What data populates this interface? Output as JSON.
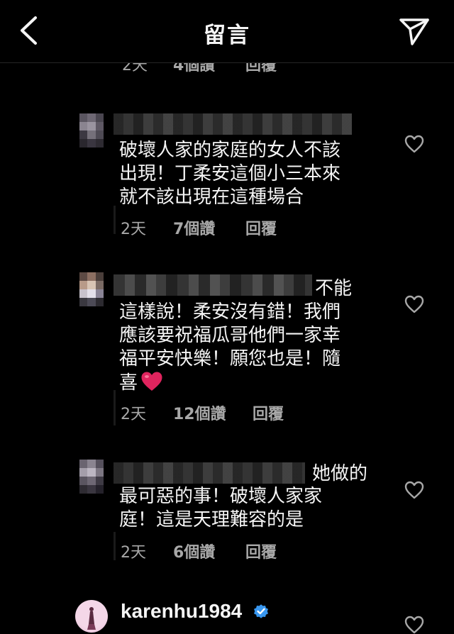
{
  "header": {
    "title": "留言"
  },
  "partial_comment": {
    "time": "2天",
    "likes": "4個讚",
    "reply": "回覆"
  },
  "comments": [
    {
      "text_lines": [
        "破壞人家的家庭的女人不該",
        "出現！丁柔安這個小三本來",
        "就不該出現在這種場合"
      ],
      "time": "2天",
      "likes": "7個讚",
      "reply": "回覆"
    },
    {
      "tail": "不能",
      "text_lines": [
        "這樣說！柔安沒有錯！我們",
        "應該要祝福瓜哥他們一家幸",
        "福平安快樂！願您也是！隨",
        "喜"
      ],
      "emoji": "red-heart",
      "time": "2天",
      "likes": "12個讚",
      "reply": "回覆"
    },
    {
      "tail": "她做的",
      "text_lines": [
        "最可惡的事！破壞人家家",
        "庭！這是天理難容的是"
      ],
      "time": "2天",
      "likes": "6個讚",
      "reply": "回覆"
    }
  ],
  "bottom_comment": {
    "username": "karenhu1984",
    "verified": true
  },
  "icons": {
    "back": "chevron-left-icon",
    "send": "send-icon",
    "like": "heart-outline-icon",
    "verified": "verified-badge-icon"
  },
  "colors": {
    "background": "#000000",
    "text": "#f5f5f5",
    "meta": "#a8a8a8",
    "verified": "#3897f0",
    "emoji_heart": "#e0245e"
  }
}
